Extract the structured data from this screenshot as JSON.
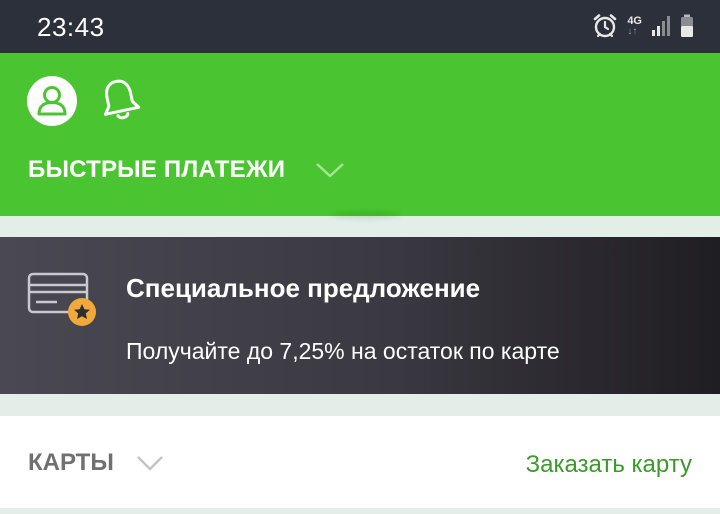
{
  "status_bar": {
    "time": "23:43",
    "network_type": "4G",
    "icons": [
      "alarm-icon",
      "network-4g-icon",
      "signal-icon",
      "battery-icon"
    ]
  },
  "header": {
    "background_color": "#4ac531",
    "icons": [
      "profile-icon",
      "bell-icon"
    ],
    "quick_payments_label": "БЫСТРЫЕ ПЛАТЕЖИ"
  },
  "promo": {
    "icon": "card-star-icon",
    "title": "Специальное предложение",
    "subtitle": "Получайте до 7,25% на остаток по карте"
  },
  "cards": {
    "label": "КАРТЫ",
    "order_link": "Заказать карту",
    "accent_color": "#3a9a2a"
  }
}
